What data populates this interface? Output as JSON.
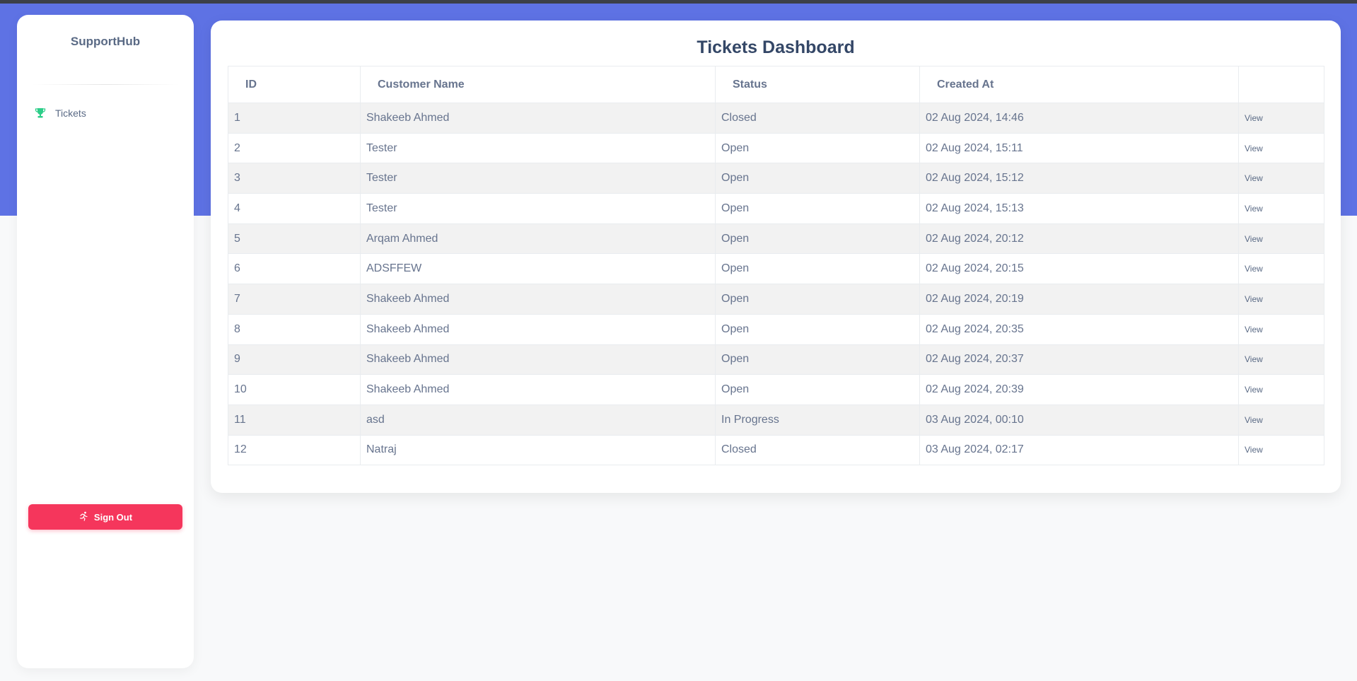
{
  "brand": {
    "name": "SupportHub"
  },
  "nav": {
    "items": [
      {
        "label": "Tickets",
        "icon": "trophy-icon"
      }
    ]
  },
  "signout": {
    "label": "Sign Out",
    "icon": "running-person-icon"
  },
  "dashboard": {
    "title": "Tickets Dashboard",
    "columns": [
      "ID",
      "Customer Name",
      "Status",
      "Created At",
      ""
    ],
    "rows": [
      {
        "id": "1",
        "customer": "Shakeeb Ahmed",
        "status": "Closed",
        "created": "02 Aug 2024, 14:46",
        "action": "View"
      },
      {
        "id": "2",
        "customer": "Tester",
        "status": "Open",
        "created": "02 Aug 2024, 15:11",
        "action": "View"
      },
      {
        "id": "3",
        "customer": "Tester",
        "status": "Open",
        "created": "02 Aug 2024, 15:12",
        "action": "View"
      },
      {
        "id": "4",
        "customer": "Tester",
        "status": "Open",
        "created": "02 Aug 2024, 15:13",
        "action": "View"
      },
      {
        "id": "5",
        "customer": "Arqam Ahmed",
        "status": "Open",
        "created": "02 Aug 2024, 20:12",
        "action": "View"
      },
      {
        "id": "6",
        "customer": "ADSFFEW",
        "status": "Open",
        "created": "02 Aug 2024, 20:15",
        "action": "View"
      },
      {
        "id": "7",
        "customer": "Shakeeb Ahmed",
        "status": "Open",
        "created": "02 Aug 2024, 20:19",
        "action": "View"
      },
      {
        "id": "8",
        "customer": "Shakeeb Ahmed",
        "status": "Open",
        "created": "02 Aug 2024, 20:35",
        "action": "View"
      },
      {
        "id": "9",
        "customer": "Shakeeb Ahmed",
        "status": "Open",
        "created": "02 Aug 2024, 20:37",
        "action": "View"
      },
      {
        "id": "10",
        "customer": "Shakeeb Ahmed",
        "status": "Open",
        "created": "02 Aug 2024, 20:39",
        "action": "View"
      },
      {
        "id": "11",
        "customer": "asd",
        "status": "In Progress",
        "created": "03 Aug 2024, 00:10",
        "action": "View"
      },
      {
        "id": "12",
        "customer": "Natraj",
        "status": "Closed",
        "created": "03 Aug 2024, 02:17",
        "action": "View"
      }
    ]
  },
  "colors": {
    "accent": "#5e72e4",
    "danger": "#f5365c",
    "icon_green": "#2dce89"
  }
}
